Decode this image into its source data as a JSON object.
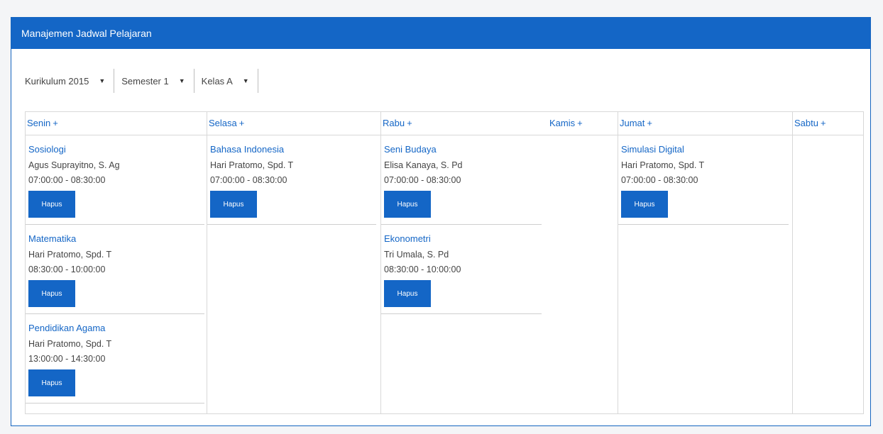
{
  "panel": {
    "title": "Manajemen Jadwal Pelajaran"
  },
  "filters": [
    {
      "label": "Kurikulum 2015"
    },
    {
      "label": "Semester 1"
    },
    {
      "label": "Kelas A"
    }
  ],
  "icons": {
    "caret": "▼"
  },
  "colors": {
    "primary": "#1466c6"
  },
  "days": {
    "senin": {
      "label": "Senin",
      "plus": "+",
      "entries": [
        {
          "subject": "Sosiologi",
          "teacher": "Agus Suprayitno, S. Ag",
          "time": "07:00:00 - 08:30:00",
          "button": "Hapus"
        },
        {
          "subject": "Matematika",
          "teacher": "Hari Pratomo, Spd. T",
          "time": "08:30:00 - 10:00:00",
          "button": "Hapus"
        },
        {
          "subject": "Pendidikan Agama",
          "teacher": "Hari Pratomo, Spd. T",
          "time": "13:00:00 - 14:30:00",
          "button": "Hapus"
        }
      ]
    },
    "selasa": {
      "label": "Selasa",
      "plus": "+",
      "entries": [
        {
          "subject": "Bahasa Indonesia",
          "teacher": "Hari Pratomo, Spd. T",
          "time": "07:00:00 - 08:30:00",
          "button": "Hapus"
        }
      ]
    },
    "rabu": {
      "label": "Rabu",
      "plus": "+",
      "entries": [
        {
          "subject": "Seni Budaya",
          "teacher": "Elisa Kanaya, S. Pd",
          "time": "07:00:00 - 08:30:00",
          "button": "Hapus"
        },
        {
          "subject": "Ekonometri",
          "teacher": "Tri Umala, S. Pd",
          "time": "08:30:00 - 10:00:00",
          "button": "Hapus"
        }
      ]
    },
    "kamis": {
      "label": "Kamis",
      "plus": "+"
    },
    "jumat": {
      "label": "Jumat",
      "plus": "+",
      "entries": [
        {
          "subject": "Simulasi Digital",
          "teacher": "Hari Pratomo, Spd. T",
          "time": "07:00:00 - 08:30:00",
          "button": "Hapus"
        }
      ]
    },
    "sabtu": {
      "label": "Sabtu",
      "plus": "+"
    }
  }
}
